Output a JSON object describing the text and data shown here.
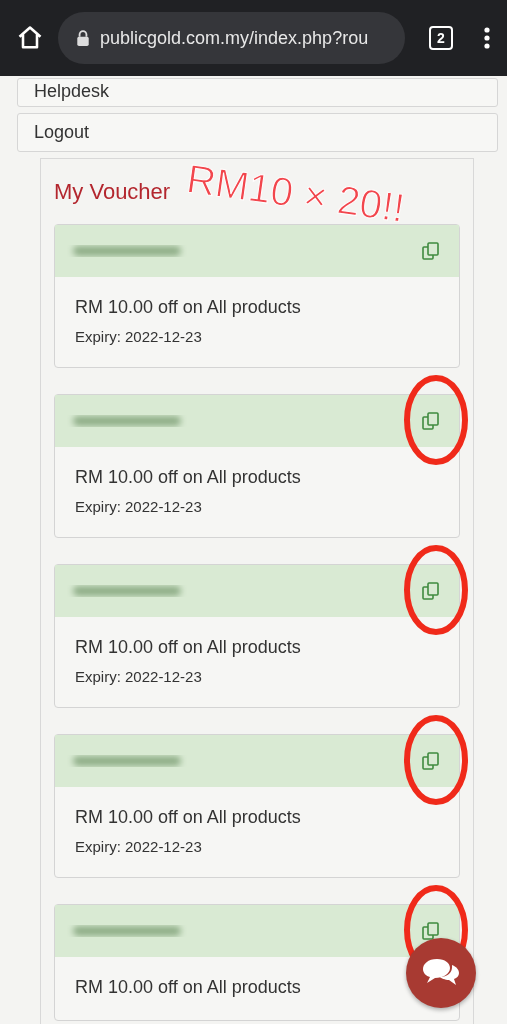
{
  "browser": {
    "url": "publicgold.com.my/index.php?rou",
    "tab_count": "2"
  },
  "menu": [
    "Helpdesk",
    "Logout"
  ],
  "section_title": "My Voucher",
  "vouchers": [
    {
      "description": "RM 10.00 off on All products",
      "expiry": "Expiry: 2022-12-23",
      "circled": false
    },
    {
      "description": "RM 10.00 off on All products",
      "expiry": "Expiry: 2022-12-23",
      "circled": true
    },
    {
      "description": "RM 10.00 off on All products",
      "expiry": "Expiry: 2022-12-23",
      "circled": true
    },
    {
      "description": "RM 10.00 off on All products",
      "expiry": "Expiry: 2022-12-23",
      "circled": true
    },
    {
      "description": "RM 10.00 off on All products",
      "circled": true
    }
  ],
  "annotation": "RM10 × 20!!"
}
